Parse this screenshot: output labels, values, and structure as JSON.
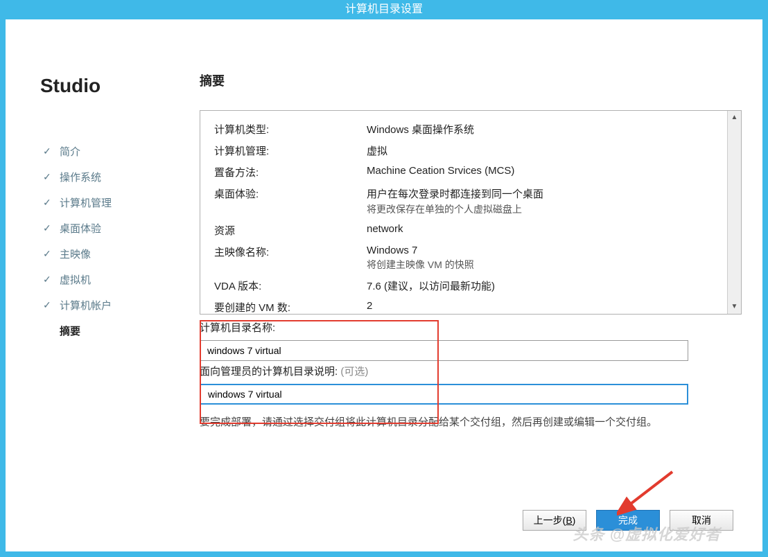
{
  "window": {
    "title": "计算机目录设置"
  },
  "sidebar": {
    "title": "Studio",
    "items": [
      {
        "label": "简介",
        "done": true
      },
      {
        "label": "操作系统",
        "done": true
      },
      {
        "label": "计算机管理",
        "done": true
      },
      {
        "label": "桌面体验",
        "done": true
      },
      {
        "label": "主映像",
        "done": true
      },
      {
        "label": "虚拟机",
        "done": true
      },
      {
        "label": "计算机帐户",
        "done": true
      },
      {
        "label": "摘要",
        "done": false,
        "active": true
      }
    ]
  },
  "main": {
    "section_title": "摘要",
    "summary": [
      {
        "label": "计算机类型:",
        "value": "Windows 桌面操作系统"
      },
      {
        "label": "计算机管理:",
        "value": "虚拟"
      },
      {
        "label": "置备方法:",
        "value": "Machine Ceation Srvices (MCS)"
      },
      {
        "label": "桌面体验:",
        "value": "用户在每次登录时都连接到同一个桌面",
        "sub": "将更改保存在单独的个人虚拟磁盘上"
      },
      {
        "label": "资源",
        "value": "network"
      },
      {
        "label": "主映像名称:",
        "value": "Windows 7",
        "sub": "将创建主映像 VM 的快照"
      },
      {
        "label": "VDA 版本:",
        "value": "7.6 (建议，以访问最新功能)"
      },
      {
        "label": "要创建的 VM 数:",
        "value": "2"
      }
    ],
    "catalog_name_label": "计算机目录名称:",
    "catalog_name_value": "windows 7 virtual",
    "description_label": "面向管理员的计算机目录说明:",
    "description_optional": "(可选)",
    "description_value": "windows 7 virtual",
    "help_text": "要完成部署，请通过选择交付组将此计算机目录分配给某个交付组，然后再创建或编辑一个交付组。"
  },
  "buttons": {
    "back": "上一步(B)",
    "finish": "完成",
    "cancel": "取消"
  },
  "watermark": "头条 @虚拟化爱好者"
}
